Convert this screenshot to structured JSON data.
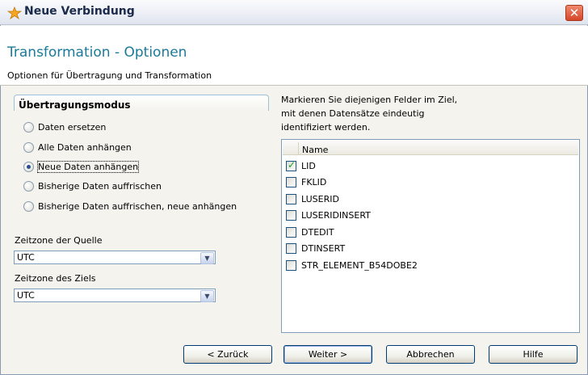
{
  "window": {
    "title": "Neue Verbindung",
    "close_label": "✕"
  },
  "header": {
    "title": "Transformation - Optionen",
    "subtitle": "Optionen für Übertragung und Transformation"
  },
  "transfer_mode": {
    "title": "Übertragungsmodus",
    "options": [
      {
        "label": "Daten ersetzen",
        "selected": false
      },
      {
        "label": "Alle Daten anhängen",
        "selected": false
      },
      {
        "label": "Neue Daten anhängen",
        "selected": true
      },
      {
        "label": "Bisherige Daten auffrischen",
        "selected": false
      },
      {
        "label": "Bisherige Daten auffrischen, neue anhängen",
        "selected": false
      }
    ]
  },
  "timezone": {
    "source_label": "Zeitzone der Quelle",
    "source_value": "UTC",
    "target_label": "Zeitzone des Ziels",
    "target_value": "UTC"
  },
  "fields": {
    "instruction": "Markieren Sie diejenigen Felder im Ziel, mit denen Datensätze eindeutig identifiziert werden.",
    "column_header": "Name",
    "items": [
      {
        "name": "LID",
        "checked": true
      },
      {
        "name": "FKLID",
        "checked": false
      },
      {
        "name": "LUSERID",
        "checked": false
      },
      {
        "name": "LUSERIDINSERT",
        "checked": false
      },
      {
        "name": "DTEDIT",
        "checked": false
      },
      {
        "name": "DTINSERT",
        "checked": false
      },
      {
        "name": "STR_ELEMENT_B54DOBE2",
        "checked": false
      }
    ]
  },
  "buttons": {
    "back": "< Zurück",
    "next": "Weiter >",
    "cancel": "Abbrechen",
    "help": "Hilfe"
  },
  "icons": {
    "title": "wizard-star-icon",
    "close": "close-icon",
    "dropdown": "chevron-down-icon"
  }
}
